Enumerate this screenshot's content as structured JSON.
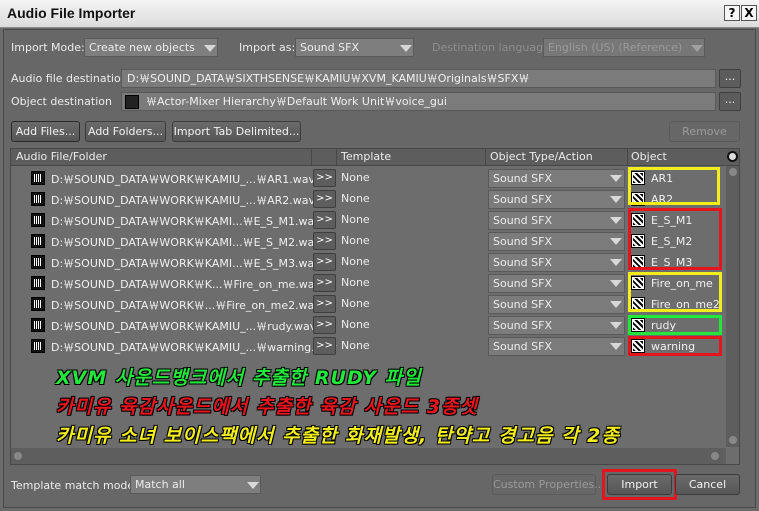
{
  "window": {
    "title": "Audio File Importer",
    "help_glyph": "?",
    "close_glyph": "X"
  },
  "options": {
    "import_mode_label": "Import Mode:",
    "import_mode_value": "Create new objects",
    "import_as_label": "Import as:",
    "import_as_value": "Sound SFX",
    "dest_lang_label": "Destination language:",
    "dest_lang_value": "English (US) (Reference)"
  },
  "destinations": {
    "audio_label": "Audio file destination",
    "audio_value": "D:￦SOUND_DATA￦SIXTHSENSE￦KAMIU￦XVM_KAMIU￦Originals￦SFX￦",
    "object_label": "Object destination",
    "object_value": "￦Actor-Mixer Hierarchy￦Default Work Unit￦voice_gui",
    "browse_label": "..."
  },
  "toolbar": {
    "add_files": "Add Files...",
    "add_folders": "Add Folders...",
    "import_tab": "Import Tab Delimited...",
    "remove": "Remove"
  },
  "table": {
    "columns": [
      "Audio File/Folder",
      "Template",
      "Object Type/Action",
      "Object"
    ],
    "rows": [
      {
        "path": "D:￦SOUND_DATA￦WORK￦KAMIU_...￦AR1.wav",
        "arrow": ">>",
        "template": "None",
        "type": "Sound SFX",
        "object": "AR1"
      },
      {
        "path": "D:￦SOUND_DATA￦WORK￦KAMIU_...￦AR2.wav",
        "arrow": ">>",
        "template": "None",
        "type": "Sound SFX",
        "object": "AR2"
      },
      {
        "path": "D:￦SOUND_DATA￦WORK￦KAMI...￦E_S_M1.wav",
        "arrow": ">>",
        "template": "None",
        "type": "Sound SFX",
        "object": "E_S_M1"
      },
      {
        "path": "D:￦SOUND_DATA￦WORK￦KAMI...￦E_S_M2.wav",
        "arrow": ">>",
        "template": "None",
        "type": "Sound SFX",
        "object": "E_S_M2"
      },
      {
        "path": "D:￦SOUND_DATA￦WORK￦KAMI...￦E_S_M3.wav",
        "arrow": ">>",
        "template": "None",
        "type": "Sound SFX",
        "object": "E_S_M3"
      },
      {
        "path": "D:￦SOUND_DATA￦WORK￦K...￦Fire_on_me.wav",
        "arrow": ">>",
        "template": "None",
        "type": "Sound SFX",
        "object": "Fire_on_me"
      },
      {
        "path": "D:￦SOUND_DATA￦WORK￦...￦Fire_on_me2.wav",
        "arrow": ">>",
        "template": "None",
        "type": "Sound SFX",
        "object": "Fire_on_me2"
      },
      {
        "path": "D:￦SOUND_DATA￦WORK￦KAMIU_...￦rudy.wav",
        "arrow": ">>",
        "template": "None",
        "type": "Sound SFX",
        "object": "rudy"
      },
      {
        "path": "D:￦SOUND_DATA￦WORK￦KAMIU_...￦warning.wav",
        "arrow": ">>",
        "template": "None",
        "type": "Sound SFX",
        "object": "warning"
      }
    ]
  },
  "annotations": {
    "line1": "XVM 사운드뱅크에서 추출한 RUDY 파일",
    "line2": "카미유 육감사운드에서 추출한 육감 사운드 3종셋",
    "line3": "카미유 소녀 보이스팩에서 추출한 화재발생, 탄약고 경고음 각 2종",
    "line1_color": "#22e83c",
    "line2_color": "#e8141e",
    "line3_color": "#f2ee1c"
  },
  "highlight_colors": {
    "yellow": "#f2ee1c",
    "red": "#e3161f",
    "green": "#22e83c"
  },
  "footer": {
    "template_match_label": "Template match mode:",
    "template_match_value": "Match all",
    "custom_props": "Custom Properties...",
    "import": "Import",
    "cancel": "Cancel"
  }
}
